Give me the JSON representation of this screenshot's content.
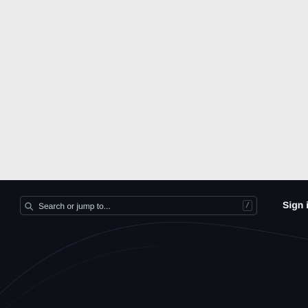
{
  "header": {
    "search": {
      "placeholder": "Search or jump to...",
      "shortcut_key": "/",
      "icon": "search-icon"
    },
    "sign_in_label": "Sign in"
  },
  "colors": {
    "page_background": "#ebebec",
    "header_background": "#0d1117",
    "search_border": "#3b4048",
    "text_light": "#f0f6fc"
  }
}
